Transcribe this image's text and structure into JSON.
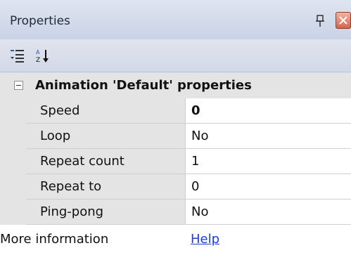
{
  "panel": {
    "title": "Properties"
  },
  "toolbar": {
    "categorized_icon": "categorized-view-icon",
    "alphabetical_icon": "sort-alphabetical-icon"
  },
  "category": {
    "label": "Animation 'Default' properties",
    "expanded": true
  },
  "properties": [
    {
      "name": "Speed",
      "value": "0"
    },
    {
      "name": "Loop",
      "value": "No"
    },
    {
      "name": "Repeat count",
      "value": "1"
    },
    {
      "name": "Repeat to",
      "value": "0"
    },
    {
      "name": "Ping-pong",
      "value": "No"
    }
  ],
  "info": {
    "label": "More information",
    "link": "Help"
  },
  "colors": {
    "titlebar": "#c9d3e6",
    "category_bg": "#e4e4e4",
    "link": "#1a3ee0",
    "close_button": "#d7644c"
  }
}
